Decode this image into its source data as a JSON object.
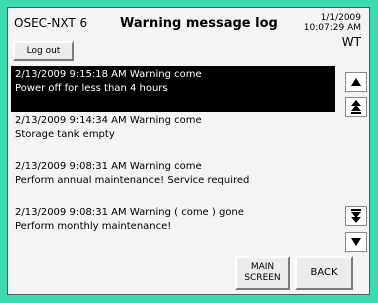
{
  "header": {
    "device_name": "OSEC-NXT 6",
    "title": "Warning message log",
    "date": "1/1/2009",
    "time": "10:07:29 AM",
    "user": "WT",
    "logout_label": "Log out"
  },
  "entries": [
    {
      "line1": "2/13/2009 9:15:18 AM Warning  come",
      "line2": "Power off for less than 4 hours",
      "selected": true
    },
    {
      "line1": "2/13/2009 9:14:34 AM Warning  come",
      "line2": "Storage tank empty",
      "selected": false
    },
    {
      "line1": "2/13/2009 9:08:31 AM Warning  come",
      "line2": "Perform annual maintenance! Service required",
      "selected": false
    },
    {
      "line1": "2/13/2009 9:08:31 AM Warning ( come ) gone",
      "line2": "Perform monthly maintenance!",
      "selected": false
    }
  ],
  "footer": {
    "main_screen_label": "MAIN SCREEN",
    "back_label": "BACK"
  },
  "icons": {
    "scroll_up": "arrow-up-icon",
    "page_up": "double-arrow-up-icon",
    "page_down": "double-arrow-down-icon",
    "scroll_down": "arrow-down-icon"
  }
}
